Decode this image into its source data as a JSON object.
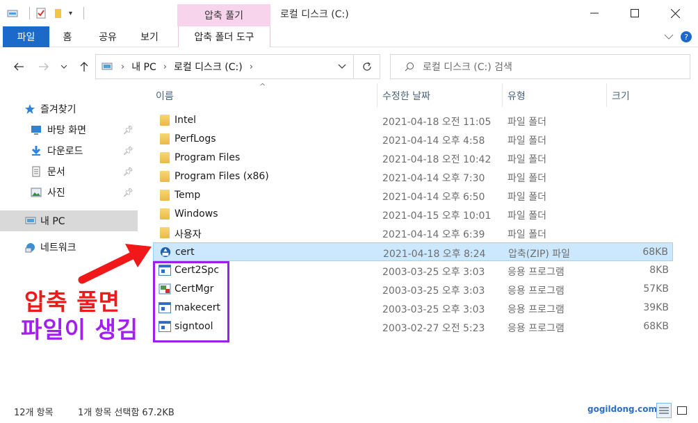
{
  "window": {
    "title": "로컬 디스크 (C:)",
    "context_tab_header": "압축 풀기"
  },
  "ribbon": {
    "tabs": [
      "파일",
      "홈",
      "공유",
      "보기"
    ],
    "context_tab": "압축 폴더 도구"
  },
  "address": {
    "crumbs": [
      "내 PC",
      "로컬 디스크 (C:)"
    ],
    "search_placeholder": "로컬 디스크 (C:) 검색"
  },
  "nav": {
    "quick_access": "즐겨찾기",
    "pinned": [
      "바탕 화면",
      "다운로드",
      "문서",
      "사진"
    ],
    "this_pc": "내 PC",
    "network": "네트워크"
  },
  "columns": {
    "name": "이름",
    "date": "수정한 날짜",
    "type": "유형",
    "size": "크기"
  },
  "files": [
    {
      "name": "Intel",
      "date": "2021-04-18 오전 11:05",
      "type": "파일 폴더",
      "size": "",
      "icon": "folder-icon"
    },
    {
      "name": "PerfLogs",
      "date": "2021-04-14 오후 4:58",
      "type": "파일 폴더",
      "size": "",
      "icon": "folder-icon"
    },
    {
      "name": "Program Files",
      "date": "2021-04-18 오전 10:42",
      "type": "파일 폴더",
      "size": "",
      "icon": "folder-icon"
    },
    {
      "name": "Program Files (x86)",
      "date": "2021-04-14 오후 7:30",
      "type": "파일 폴더",
      "size": "",
      "icon": "folder-icon"
    },
    {
      "name": "Temp",
      "date": "2021-04-14 오후 6:50",
      "type": "파일 폴더",
      "size": "",
      "icon": "folder-icon"
    },
    {
      "name": "Windows",
      "date": "2021-04-15 오후 10:01",
      "type": "파일 폴더",
      "size": "",
      "icon": "folder-icon"
    },
    {
      "name": "사용자",
      "date": "2021-04-14 오후 6:39",
      "type": "파일 폴더",
      "size": "",
      "icon": "folder-icon"
    },
    {
      "name": "cert",
      "date": "2021-04-18 오후 8:24",
      "type": "압축(ZIP) 파일",
      "size": "68KB",
      "icon": "zip-icon",
      "selected": true
    },
    {
      "name": "Cert2Spc",
      "date": "2003-03-25 오후 3:03",
      "type": "응용 프로그램",
      "size": "8KB",
      "icon": "exe-icon"
    },
    {
      "name": "CertMgr",
      "date": "2003-03-25 오후 3:03",
      "type": "응용 프로그램",
      "size": "57KB",
      "icon": "certmgr-icon"
    },
    {
      "name": "makecert",
      "date": "2003-03-25 오후 3:03",
      "type": "응용 프로그램",
      "size": "39KB",
      "icon": "exe-icon"
    },
    {
      "name": "signtool",
      "date": "2003-02-27 오전 5:23",
      "type": "응용 프로그램",
      "size": "68KB",
      "icon": "exe-icon"
    }
  ],
  "annotation": {
    "line1": "압축 풀면",
    "line2": "파일이 생김",
    "arrow_color": "#f01818",
    "box_color": "#9b1fe8"
  },
  "status": {
    "count": "12개 항목",
    "selection": "1개 항목 선택함 67.2KB",
    "watermark": "gogildong.com"
  },
  "colors": {
    "accent": "#1b6ac9",
    "selection_bg": "#cce8ff",
    "context_tab": "#f7d4ec"
  }
}
